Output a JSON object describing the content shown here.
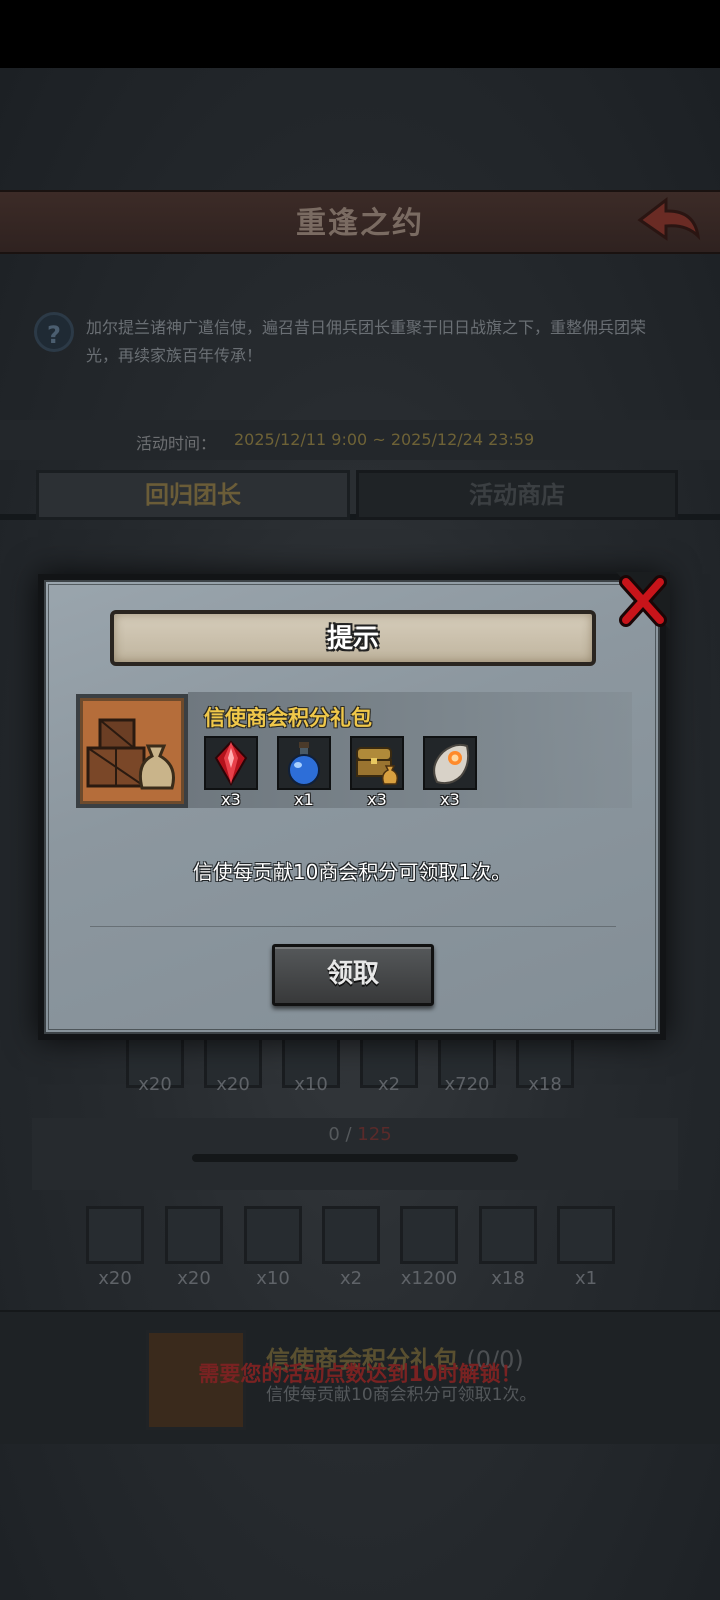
{
  "header": {
    "title": "重逢之约"
  },
  "event": {
    "description": "加尔提兰诸神广遣信使，遍召昔日佣兵团长重聚于旧日战旗之下，重整佣兵团荣光，再续家族百年传承！",
    "time_label": "活动时间：",
    "time_value": "2025/12/11 9:00 ~ 2025/12/24 23:59"
  },
  "tabs": [
    {
      "label": "回归团长",
      "active": true
    },
    {
      "label": "活动商店",
      "active": false
    }
  ],
  "background_rewards_row1": [
    "x20",
    "x20",
    "x10",
    "x2",
    "x720",
    "x18"
  ],
  "progress": {
    "current": "0",
    "separator": " / ",
    "target": "125"
  },
  "background_rewards_row2": [
    "x20",
    "x20",
    "x10",
    "x2",
    "x1200",
    "x18",
    "x1"
  ],
  "bottom_pack": {
    "title": "信使商会积分礼包",
    "count": "(0/0)",
    "subtitle": "信使每贡献10商会积分可领取1次。",
    "lock_message": "需要您的活动点数达到10时解锁！"
  },
  "modal": {
    "title": "提示",
    "pack_name": "信使商会积分礼包",
    "rewards": [
      {
        "icon": "red-crystal-icon",
        "count": "x3"
      },
      {
        "icon": "blue-potion-icon",
        "count": "x1"
      },
      {
        "icon": "treasure-chest-icon",
        "count": "x3"
      },
      {
        "icon": "fire-egg-icon",
        "count": "x3"
      }
    ],
    "description": "信使每贡献10商会积分可领取1次。",
    "claim_label": "领取"
  },
  "colors": {
    "accent_gold": "#f0c84a",
    "close_red": "#c8141a",
    "progress_target_red": "#5a2a2a"
  }
}
